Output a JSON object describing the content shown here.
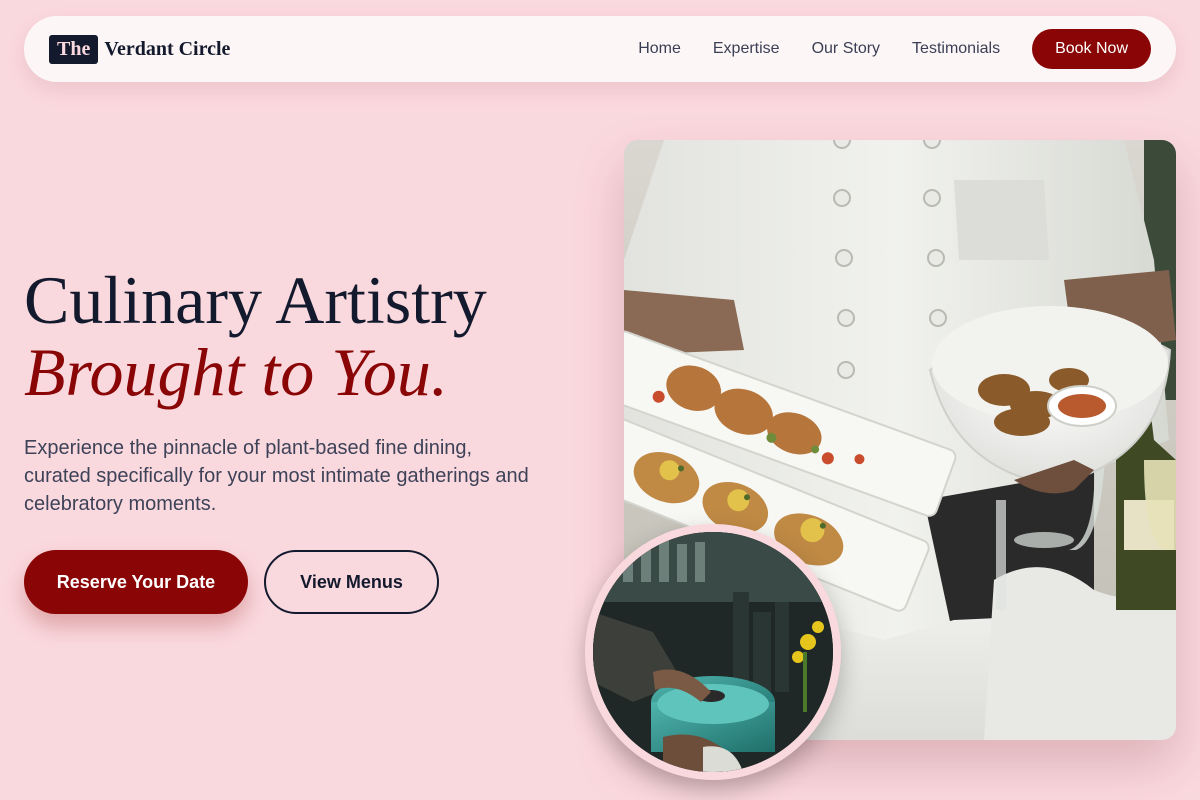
{
  "nav": {
    "logo_badge": "The",
    "logo_text": "Verdant Circle",
    "links": [
      "Home",
      "Expertise",
      "Our Story",
      "Testimonials"
    ],
    "cta": "Book Now"
  },
  "hero": {
    "title_line1": "Culinary Artistry",
    "title_line2": "Brought to You.",
    "subtitle": "Experience the pinnacle of plant-based fine dining, curated specifically for your most intimate gatherings and celebratory moments.",
    "primary_button": "Reserve Your Date",
    "secondary_button": "View Menus"
  },
  "images": {
    "main": "chef-serving-plated-dishes-photo",
    "inset": "chef-cooking-in-kitchen-photo"
  },
  "colors": {
    "background": "#fad9de",
    "accent": "#8a0505",
    "ink": "#141a2e"
  }
}
